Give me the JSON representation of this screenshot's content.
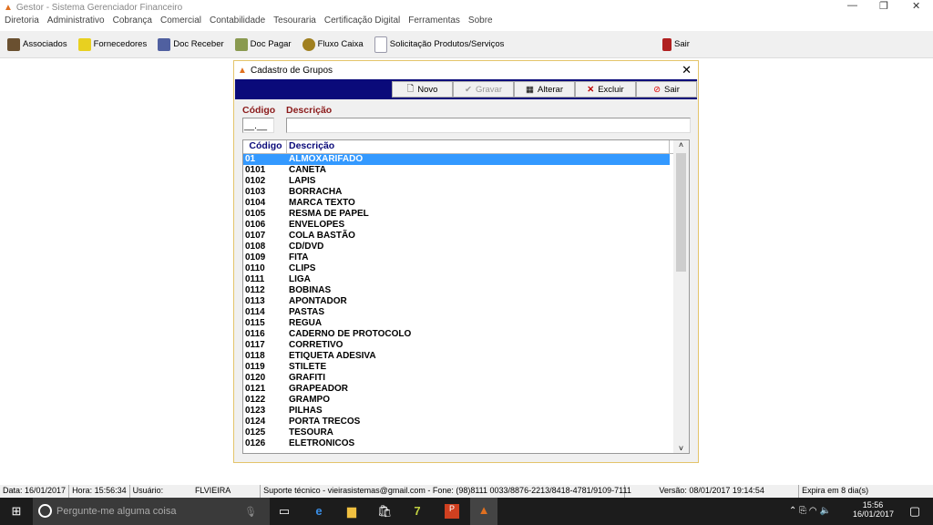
{
  "app": {
    "title": "Gestor - Sistema Gerenciador Financeiro"
  },
  "menu": [
    "Diretoria",
    "Administrativo",
    "Cobrança",
    "Comercial",
    "Contabilidade",
    "Tesouraria",
    "Certificação Digital",
    "Ferramentas",
    "Sobre"
  ],
  "toolbar": {
    "items": [
      "Associados",
      "Fornecedores",
      "Doc Receber",
      "Doc Pagar",
      "Fluxo Caixa",
      "Solicitação Produtos/Serviços"
    ],
    "exit": "Sair"
  },
  "dialog": {
    "title": "Cadastro de Grupos",
    "buttons": {
      "novo": "Novo",
      "gravar": "Gravar",
      "alterar": "Alterar",
      "excluir": "Excluir",
      "sair": "Sair"
    },
    "codigo_label": "Código",
    "descricao_label": "Descrição",
    "codigo_value": "__.__",
    "descricao_value": "",
    "grid": {
      "headers": [
        "Código",
        "Descrição"
      ],
      "rows": [
        [
          "01",
          "ALMOXARIFADO"
        ],
        [
          "0101",
          "CANETA"
        ],
        [
          "0102",
          "LAPIS"
        ],
        [
          "0103",
          "BORRACHA"
        ],
        [
          "0104",
          "MARCA TEXTO"
        ],
        [
          "0105",
          "RESMA DE PAPEL"
        ],
        [
          "0106",
          "ENVELOPES"
        ],
        [
          "0107",
          "COLA BASTÃO"
        ],
        [
          "0108",
          "CD/DVD"
        ],
        [
          "0109",
          "FITA"
        ],
        [
          "0110",
          "CLIPS"
        ],
        [
          "0111",
          "LIGA"
        ],
        [
          "0112",
          "BOBINAS"
        ],
        [
          "0113",
          "APONTADOR"
        ],
        [
          "0114",
          "PASTAS"
        ],
        [
          "0115",
          "REGUA"
        ],
        [
          "0116",
          "CADERNO DE PROTOCOLO"
        ],
        [
          "0117",
          "CORRETIVO"
        ],
        [
          "0118",
          "ETIQUETA ADESIVA"
        ],
        [
          "0119",
          "STILETE"
        ],
        [
          "0120",
          "GRAFITI"
        ],
        [
          "0121",
          "GRAPEADOR"
        ],
        [
          "0122",
          "GRAMPO"
        ],
        [
          "0123",
          "PILHAS"
        ],
        [
          "0124",
          "PORTA TRECOS"
        ],
        [
          "0125",
          "TESOURA"
        ],
        [
          "0126",
          "ELETRONICOS"
        ]
      ],
      "selected": 0
    }
  },
  "status": {
    "data": "Data: 16/01/2017",
    "hora": "Hora: 15:56:34",
    "usuario_label": "Usuário:",
    "usuario": "FLVIEIRA",
    "suporte": "Suporte técnico - vieirasistemas@gmail.com - Fone: (98)8111 0033/8876-2213/8418-4781/9109-7111",
    "versao": "Versão: 08/01/2017 19:14:54",
    "expira": "Expira em 8 dia(s)"
  },
  "taskbar": {
    "search_placeholder": "Pergunte-me alguma coisa",
    "time": "15:56",
    "date": "16/01/2017"
  },
  "colors": {
    "band": "#0a0a7a",
    "selection": "#3399ff",
    "label": "#8b1a1a"
  }
}
